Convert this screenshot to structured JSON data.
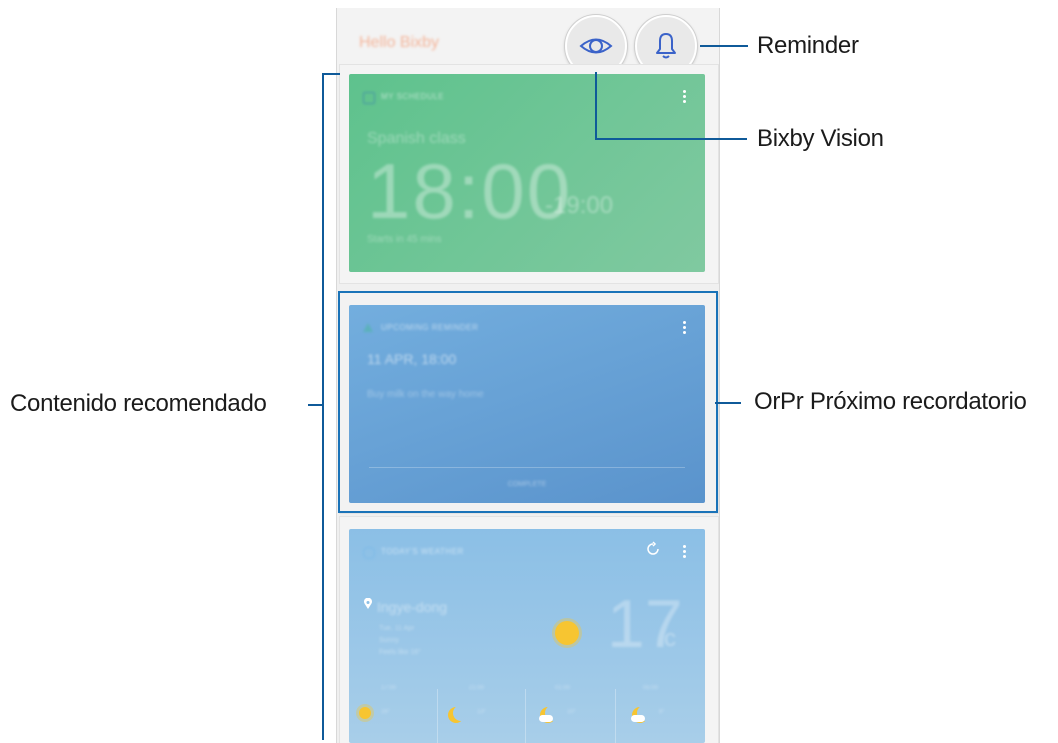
{
  "app": {
    "header_title": "Hello Bixby",
    "vision_button": "bixby-vision",
    "reminder_button": "reminder"
  },
  "cards": {
    "schedule": {
      "header": "MY SCHEDULE",
      "title": "Spanish class",
      "start_time": "18:00",
      "end_time": "-19:00",
      "subtitle": "Starts in 45 mins"
    },
    "reminder": {
      "header": "UPCOMING REMINDER",
      "date": "11 APR, 18:00",
      "note": "Buy milk on the way home",
      "action": "COMPLETE"
    },
    "weather": {
      "header": "TODAY'S WEATHER",
      "location": "Ingye-dong",
      "line1": "Tue, 11 Apr",
      "line2": "Sunny",
      "line3": "Feels like 16°",
      "temperature": "17",
      "unit": "c",
      "forecast": [
        {
          "time": "17:00",
          "temp": "16°",
          "icon": "sun-icon"
        },
        {
          "time": "21:00",
          "temp": "13°",
          "icon": "moon-icon"
        },
        {
          "time": "01:00",
          "temp": "10°",
          "icon": "moon-cloud-icon"
        },
        {
          "time": "05:00",
          "temp": "8°",
          "icon": "moon-cloud-icon"
        }
      ]
    }
  },
  "callouts": {
    "reminder": "Reminder",
    "bixby_vision": "Bixby Vision",
    "recommended": "Contenido recomendado",
    "upcoming": "OrPr Próximo recordatorio"
  },
  "colors": {
    "leader_line": "#0f5a99",
    "highlight": "#1a73b8",
    "schedule_card": "#6bc596",
    "reminder_card": "#6aa4d8",
    "weather_card": "#96c6e8"
  }
}
